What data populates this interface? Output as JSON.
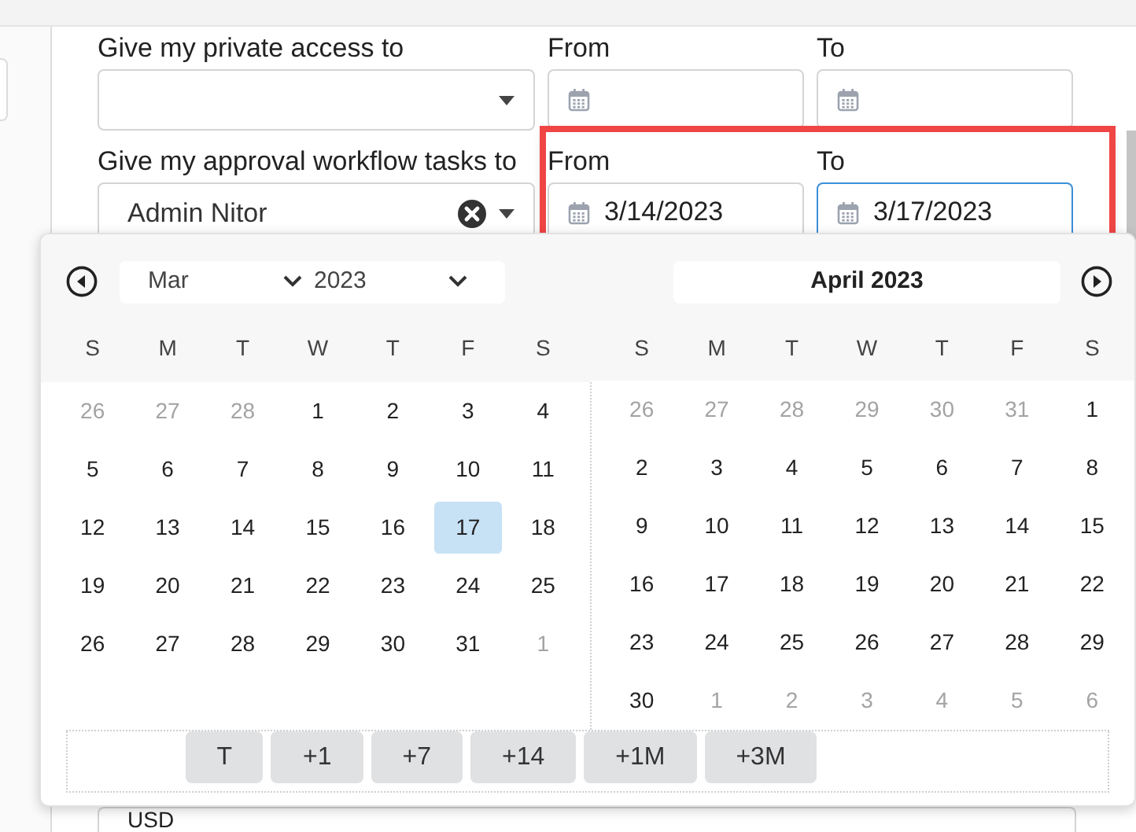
{
  "form": {
    "rows": [
      {
        "label": "Give my private access to",
        "select": {
          "clearable": false
        },
        "from": {
          "label": "From"
        },
        "to": {
          "label": "To",
          "focused": false
        },
        "highlighted": false
      },
      {
        "label": "Give my approval workflow tasks to",
        "select": {
          "value": "Admin Nitor",
          "clearable": true
        },
        "from": {
          "label": "From",
          "value": "3/14/2023"
        },
        "to": {
          "label": "To",
          "value": "3/17/2023",
          "focused": true
        },
        "highlighted": true
      }
    ],
    "currency": {
      "value": "USD"
    }
  },
  "calendar": {
    "months": [
      {
        "kind": "dropdowns",
        "month": "Mar",
        "year": "2023",
        "weekdays": [
          "S",
          "M",
          "T",
          "W",
          "T",
          "F",
          "S"
        ],
        "days": [
          {
            "label": "26",
            "muted": true,
            "selected": false
          },
          {
            "label": "27",
            "muted": true,
            "selected": false
          },
          {
            "label": "28",
            "muted": true,
            "selected": false
          },
          {
            "label": "1",
            "muted": false,
            "selected": false
          },
          {
            "label": "2",
            "muted": false,
            "selected": false
          },
          {
            "label": "3",
            "muted": false,
            "selected": false
          },
          {
            "label": "4",
            "muted": false,
            "selected": false
          },
          {
            "label": "5",
            "muted": false,
            "selected": false
          },
          {
            "label": "6",
            "muted": false,
            "selected": false
          },
          {
            "label": "7",
            "muted": false,
            "selected": false
          },
          {
            "label": "8",
            "muted": false,
            "selected": false
          },
          {
            "label": "9",
            "muted": false,
            "selected": false
          },
          {
            "label": "10",
            "muted": false,
            "selected": false
          },
          {
            "label": "11",
            "muted": false,
            "selected": false
          },
          {
            "label": "12",
            "muted": false,
            "selected": false
          },
          {
            "label": "13",
            "muted": false,
            "selected": false
          },
          {
            "label": "14",
            "muted": false,
            "selected": false
          },
          {
            "label": "15",
            "muted": false,
            "selected": false
          },
          {
            "label": "16",
            "muted": false,
            "selected": false
          },
          {
            "label": "17",
            "muted": false,
            "selected": true
          },
          {
            "label": "18",
            "muted": false,
            "selected": false
          },
          {
            "label": "19",
            "muted": false,
            "selected": false
          },
          {
            "label": "20",
            "muted": false,
            "selected": false
          },
          {
            "label": "21",
            "muted": false,
            "selected": false
          },
          {
            "label": "22",
            "muted": false,
            "selected": false
          },
          {
            "label": "23",
            "muted": false,
            "selected": false
          },
          {
            "label": "24",
            "muted": false,
            "selected": false
          },
          {
            "label": "25",
            "muted": false,
            "selected": false
          },
          {
            "label": "26",
            "muted": false,
            "selected": false
          },
          {
            "label": "27",
            "muted": false,
            "selected": false
          },
          {
            "label": "28",
            "muted": false,
            "selected": false
          },
          {
            "label": "29",
            "muted": false,
            "selected": false
          },
          {
            "label": "30",
            "muted": false,
            "selected": false
          },
          {
            "label": "31",
            "muted": false,
            "selected": false
          },
          {
            "label": "1",
            "muted": true,
            "selected": false
          }
        ]
      },
      {
        "kind": "title",
        "title": "April 2023",
        "weekdays": [
          "S",
          "M",
          "T",
          "W",
          "T",
          "F",
          "S"
        ],
        "days": [
          {
            "label": "26",
            "muted": true,
            "selected": false
          },
          {
            "label": "27",
            "muted": true,
            "selected": false
          },
          {
            "label": "28",
            "muted": true,
            "selected": false
          },
          {
            "label": "29",
            "muted": true,
            "selected": false
          },
          {
            "label": "30",
            "muted": true,
            "selected": false
          },
          {
            "label": "31",
            "muted": true,
            "selected": false
          },
          {
            "label": "1",
            "muted": false,
            "selected": false
          },
          {
            "label": "2",
            "muted": false,
            "selected": false
          },
          {
            "label": "3",
            "muted": false,
            "selected": false
          },
          {
            "label": "4",
            "muted": false,
            "selected": false
          },
          {
            "label": "5",
            "muted": false,
            "selected": false
          },
          {
            "label": "6",
            "muted": false,
            "selected": false
          },
          {
            "label": "7",
            "muted": false,
            "selected": false
          },
          {
            "label": "8",
            "muted": false,
            "selected": false
          },
          {
            "label": "9",
            "muted": false,
            "selected": false
          },
          {
            "label": "10",
            "muted": false,
            "selected": false
          },
          {
            "label": "11",
            "muted": false,
            "selected": false
          },
          {
            "label": "12",
            "muted": false,
            "selected": false
          },
          {
            "label": "13",
            "muted": false,
            "selected": false
          },
          {
            "label": "14",
            "muted": false,
            "selected": false
          },
          {
            "label": "15",
            "muted": false,
            "selected": false
          },
          {
            "label": "16",
            "muted": false,
            "selected": false
          },
          {
            "label": "17",
            "muted": false,
            "selected": false
          },
          {
            "label": "18",
            "muted": false,
            "selected": false
          },
          {
            "label": "19",
            "muted": false,
            "selected": false
          },
          {
            "label": "20",
            "muted": false,
            "selected": false
          },
          {
            "label": "21",
            "muted": false,
            "selected": false
          },
          {
            "label": "22",
            "muted": false,
            "selected": false
          },
          {
            "label": "23",
            "muted": false,
            "selected": false
          },
          {
            "label": "24",
            "muted": false,
            "selected": false
          },
          {
            "label": "25",
            "muted": false,
            "selected": false
          },
          {
            "label": "26",
            "muted": false,
            "selected": false
          },
          {
            "label": "27",
            "muted": false,
            "selected": false
          },
          {
            "label": "28",
            "muted": false,
            "selected": false
          },
          {
            "label": "29",
            "muted": false,
            "selected": false
          },
          {
            "label": "30",
            "muted": false,
            "selected": false
          },
          {
            "label": "1",
            "muted": true,
            "selected": false
          },
          {
            "label": "2",
            "muted": true,
            "selected": false
          },
          {
            "label": "3",
            "muted": true,
            "selected": false
          },
          {
            "label": "4",
            "muted": true,
            "selected": false
          },
          {
            "label": "5",
            "muted": true,
            "selected": false
          },
          {
            "label": "6",
            "muted": true,
            "selected": false
          }
        ]
      }
    ],
    "quick_buttons": [
      "T",
      "+1",
      "+7",
      "+14",
      "+1M",
      "+3M"
    ]
  }
}
